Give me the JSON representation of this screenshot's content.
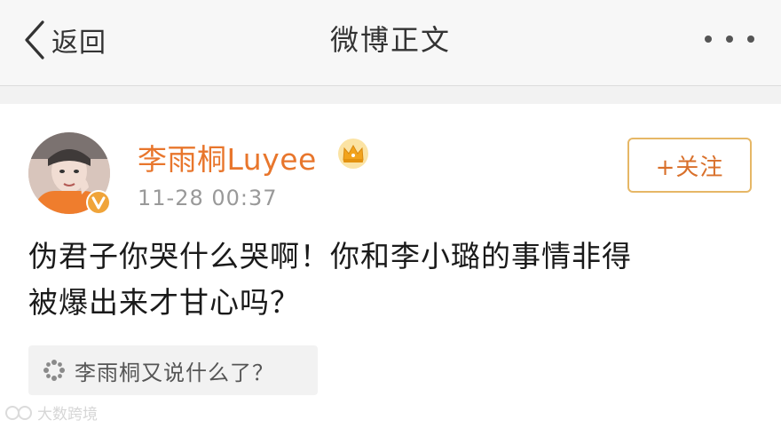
{
  "navbar": {
    "back_label": "返回",
    "title": "微博正文"
  },
  "post": {
    "username": "李雨桐Luyee",
    "timestamp": "11-28 00:37",
    "follow_label": "+关注",
    "text_line1": "伪君子你哭什么哭啊！你和李小璐的事情非得",
    "text_line2": "被爆出来才甘心吗？",
    "topic_label": "李雨桐又说什么了？"
  },
  "watermark": {
    "text": "大数跨境"
  },
  "colors": {
    "username": "#e8762c",
    "follow_border": "#e6b766",
    "follow_text": "#d9702b",
    "navbar_bg": "#f7f7f7",
    "verified_badge": "#f0a43a"
  },
  "icons": {
    "back": "chevron-left-icon",
    "more": "more-dots-icon",
    "crown": "crown-icon",
    "verified": "verified-badge-icon",
    "topic": "topic-icon"
  }
}
